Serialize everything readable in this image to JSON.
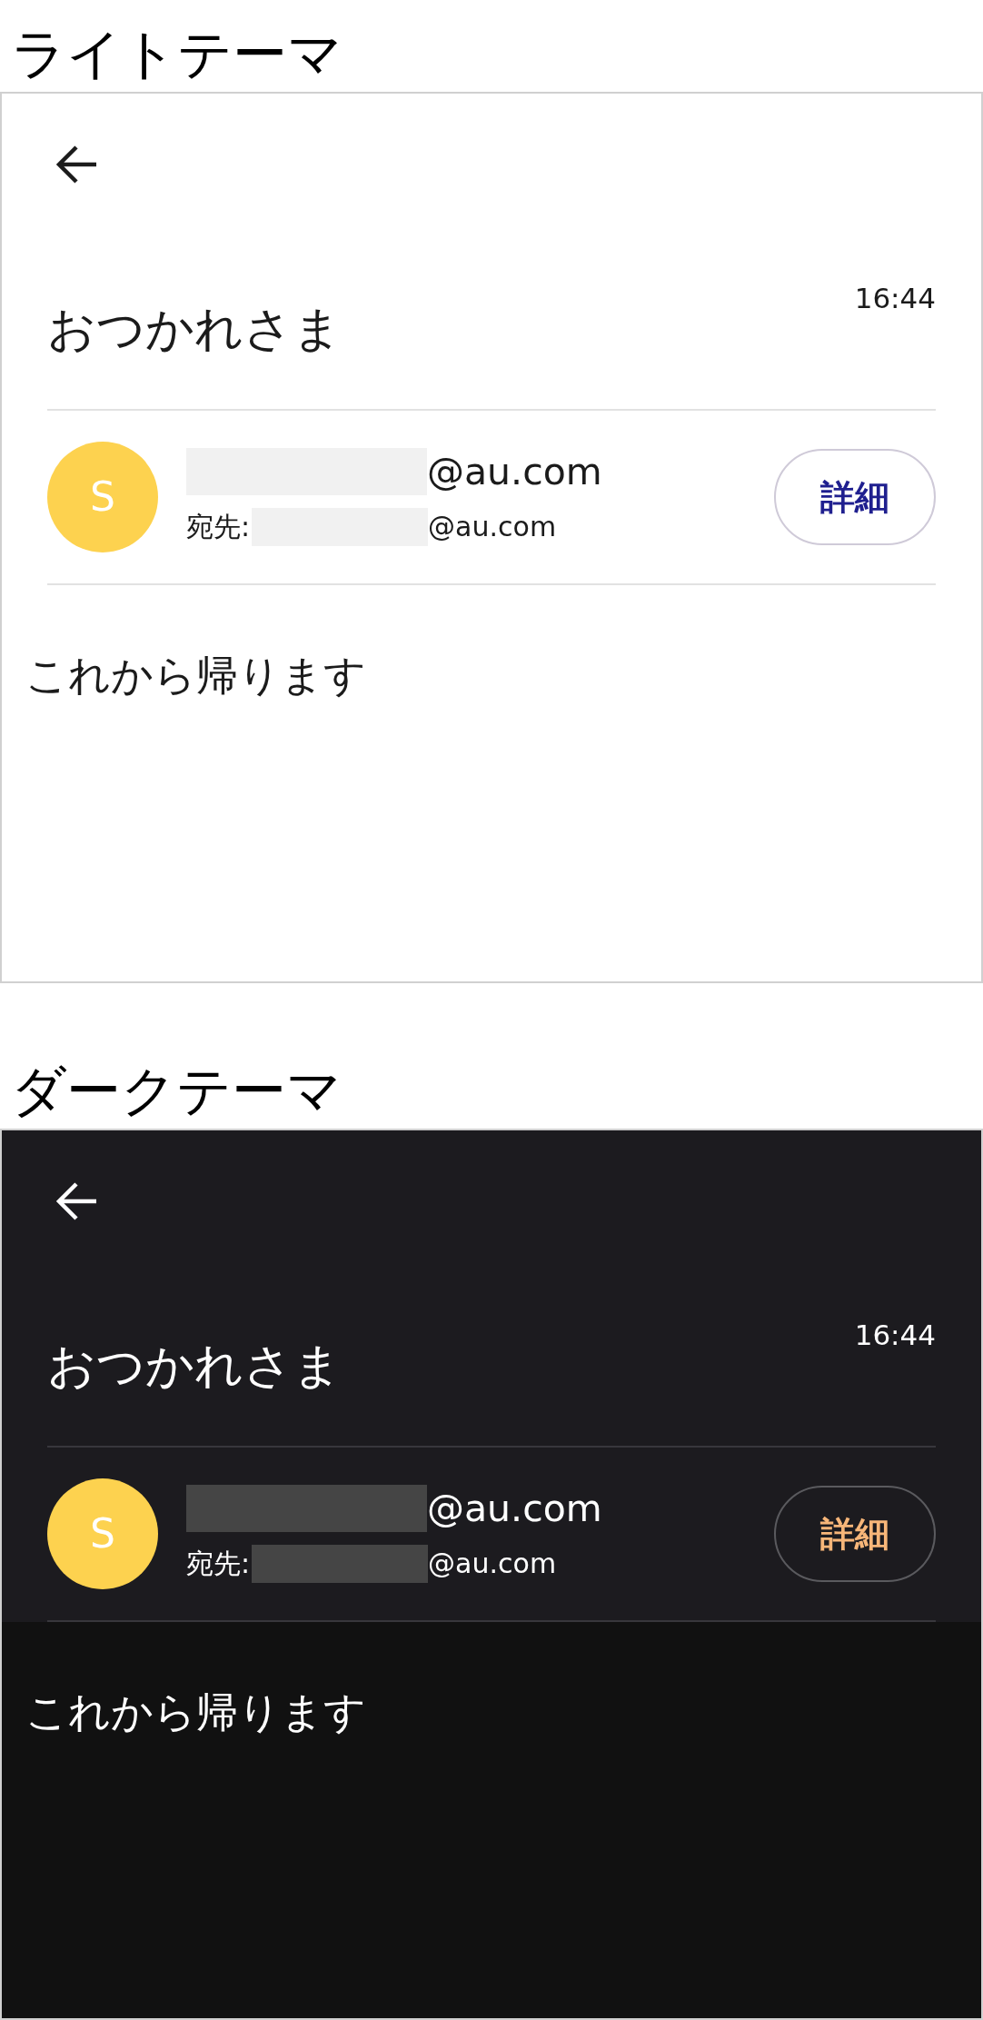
{
  "sections": [
    {
      "heading": "ライトテーマ",
      "kind": "light",
      "screen": {
        "subject": "おつかれさま",
        "time": "16:44",
        "avatar_letter": "S",
        "sender_domain": "@au.com",
        "to_label": "宛先:",
        "to_domain": "@au.com",
        "details_button": "詳細",
        "body": "これから帰ります"
      }
    },
    {
      "heading": "ダークテーマ",
      "kind": "dark",
      "screen": {
        "subject": "おつかれさま",
        "time": "16:44",
        "avatar_letter": "S",
        "sender_domain": "@au.com",
        "to_label": "宛先:",
        "to_domain": "@au.com",
        "details_button": "詳細",
        "body": "これから帰ります"
      }
    }
  ]
}
